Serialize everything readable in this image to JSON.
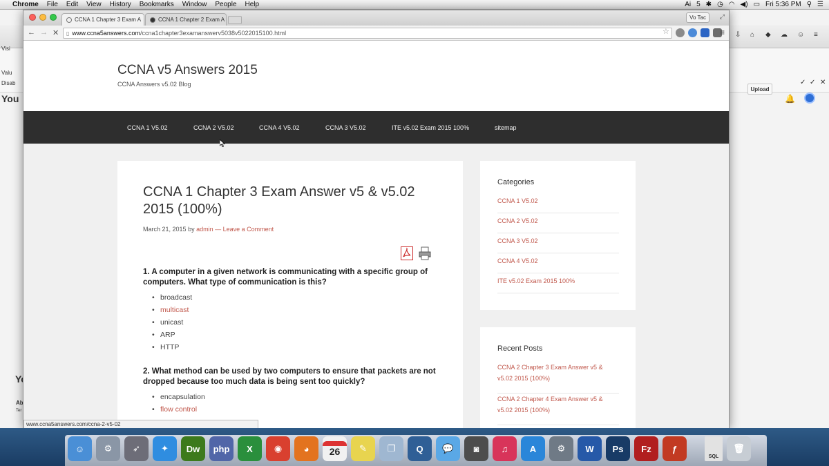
{
  "menubar": {
    "app_name": "Chrome",
    "items": [
      "File",
      "Edit",
      "View",
      "History",
      "Bookmarks",
      "Window",
      "People",
      "Help"
    ],
    "clock": "Fri 5:36 PM",
    "battery_indicator": "5"
  },
  "background_window": {
    "left_item_1": "Visi",
    "left_item_2": "Valu",
    "left_item_3": "Disab",
    "left_heading": "You",
    "left_heading_2": "Yo",
    "left_small_1": "Ab",
    "left_small_2": "Ter",
    "upload_label": "Upload"
  },
  "browser": {
    "tabs": [
      {
        "title": "CCNA 1 Chapter 3 Exam A"
      },
      {
        "title": "CCNA 1 Chapter 2 Exam A"
      }
    ],
    "profile_name": "Vo Tac",
    "url_host": "www.ccna5answers.com",
    "url_path": "/ccna1chapter3examanswerv5038v5022015100.html",
    "status_url": "www.ccna5answers.com/ccna-2-v5-02"
  },
  "site": {
    "title": "CCNA v5 Answers 2015",
    "description": "CCNA Answers v5.02 Blog",
    "nav": [
      "CCNA 1 V5.02",
      "CCNA 2 V5.02",
      "CCNA 4 V5.02",
      "CCNA 3 V5.02",
      "ITE v5.02 Exam 2015 100%",
      "sitemap"
    ]
  },
  "post": {
    "title": "CCNA 1 Chapter 3 Exam Answer v5 & v5.02 2015 (100%)",
    "date": "March 21, 2015",
    "by": "by",
    "author": "admin",
    "separator": "—",
    "comment_link": "Leave a Comment",
    "questions": [
      {
        "text": "1. A computer in a given network is communicating with a specific group of computers. What type of communication is this?",
        "answers": [
          {
            "text": "broadcast",
            "correct": false
          },
          {
            "text": "multicast",
            "correct": true
          },
          {
            "text": "unicast",
            "correct": false
          },
          {
            "text": "ARP",
            "correct": false
          },
          {
            "text": "HTTP",
            "correct": false
          }
        ]
      },
      {
        "text": "2. What method can be used by two computers to ensure that packets are not dropped because too much data is being sent too quickly?",
        "answers": [
          {
            "text": "encapsulation",
            "correct": false
          },
          {
            "text": "flow control",
            "correct": true
          }
        ]
      }
    ]
  },
  "sidebar": {
    "categories_title": "Categories",
    "categories": [
      "CCNA 1 V5.02",
      "CCNA 2 V5.02",
      "CCNA 3 V5.02",
      "CCNA 4 V5.02",
      "ITE v5.02 Exam 2015 100%"
    ],
    "recent_title": "Recent Posts",
    "recent_posts": [
      "CCNA 2 Chapter 3 Exam Answer v5 & v5.02 2015 (100%)",
      "CCNA 2 Chapter 4 Exam Answer v5 & v5.02 2015 (100%)"
    ]
  },
  "dock": {
    "calendar_day": "26",
    "icons": [
      {
        "name": "finder-icon",
        "color": "#4a8fd6",
        "glyph": "☺"
      },
      {
        "name": "system-preferences-icon",
        "color": "#8a96a6",
        "glyph": "⚙"
      },
      {
        "name": "launchpad-icon",
        "color": "#6d6d78",
        "glyph": "➶"
      },
      {
        "name": "safari-icon",
        "color": "#2f8de0",
        "glyph": "✦"
      },
      {
        "name": "dreamweaver-icon",
        "color": "#3d7a1c",
        "glyph": "Dw"
      },
      {
        "name": "php-icon",
        "color": "#5166a8",
        "glyph": "php"
      },
      {
        "name": "excel-icon",
        "color": "#2a8f3c",
        "glyph": "X"
      },
      {
        "name": "chrome-icon",
        "color": "#d9402f",
        "glyph": "◉"
      },
      {
        "name": "firefox-icon",
        "color": "#e3731f",
        "glyph": "◕"
      },
      {
        "name": "calendar-icon",
        "color": "#f1f1f1",
        "glyph": ""
      },
      {
        "name": "stickies-icon",
        "color": "#e8d44f",
        "glyph": "✎"
      },
      {
        "name": "preview-icon",
        "color": "#9fb7d1",
        "glyph": "❐"
      },
      {
        "name": "quicktime-icon",
        "color": "#2f5f96",
        "glyph": "Q"
      },
      {
        "name": "messages-icon",
        "color": "#5aa8e6",
        "glyph": "💬"
      },
      {
        "name": "image-capture-icon",
        "color": "#4d4d4d",
        "glyph": "◙"
      },
      {
        "name": "itunes-icon",
        "color": "#d8345a",
        "glyph": "♫"
      },
      {
        "name": "app-store-icon",
        "color": "#2a86d9",
        "glyph": "A"
      },
      {
        "name": "utility-icon",
        "color": "#6f7a86",
        "glyph": "⚙"
      },
      {
        "name": "word-icon",
        "color": "#2659a8",
        "glyph": "W"
      },
      {
        "name": "photoshop-icon",
        "color": "#183b66",
        "glyph": "Ps"
      },
      {
        "name": "filezilla-icon",
        "color": "#b11f1f",
        "glyph": "Fz"
      },
      {
        "name": "flash-icon",
        "color": "#c23a22",
        "glyph": "ƒ"
      },
      {
        "name": "sql-file-icon",
        "color": "#e2e2e2",
        "glyph": ""
      },
      {
        "name": "trash-icon",
        "color": "#c7cdd4",
        "glyph": "🗑"
      }
    ],
    "sql_label": "SQL"
  },
  "colors": {
    "accent_link": "#c0574b",
    "navbar_bg": "#2e2e2e"
  }
}
